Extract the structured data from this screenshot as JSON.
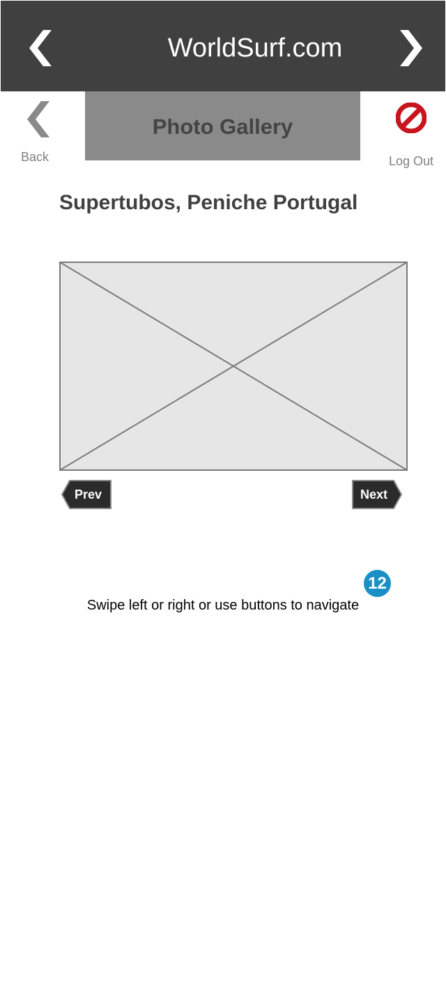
{
  "header": {
    "site_title": "WorldSurf.com",
    "left_icon": "chevron-left-icon",
    "right_icon": "chevron-right-icon",
    "background": "#404040"
  },
  "subnav": {
    "back_label": "Back",
    "tab_label": "Photo Gallery",
    "logout_label": "Log Out",
    "logout_icon": "no-entry-icon",
    "logout_icon_color": "#c8141e"
  },
  "photo": {
    "title": "Supertubos, Peniche Portugal",
    "placeholder_icon": "image-placeholder-icon"
  },
  "navigation": {
    "prev_label": "Prev",
    "next_label": "Next",
    "hint": "Swipe left or right or use buttons to navigate"
  },
  "annotation": {
    "badge": "12",
    "color": "#1a8fc6"
  }
}
